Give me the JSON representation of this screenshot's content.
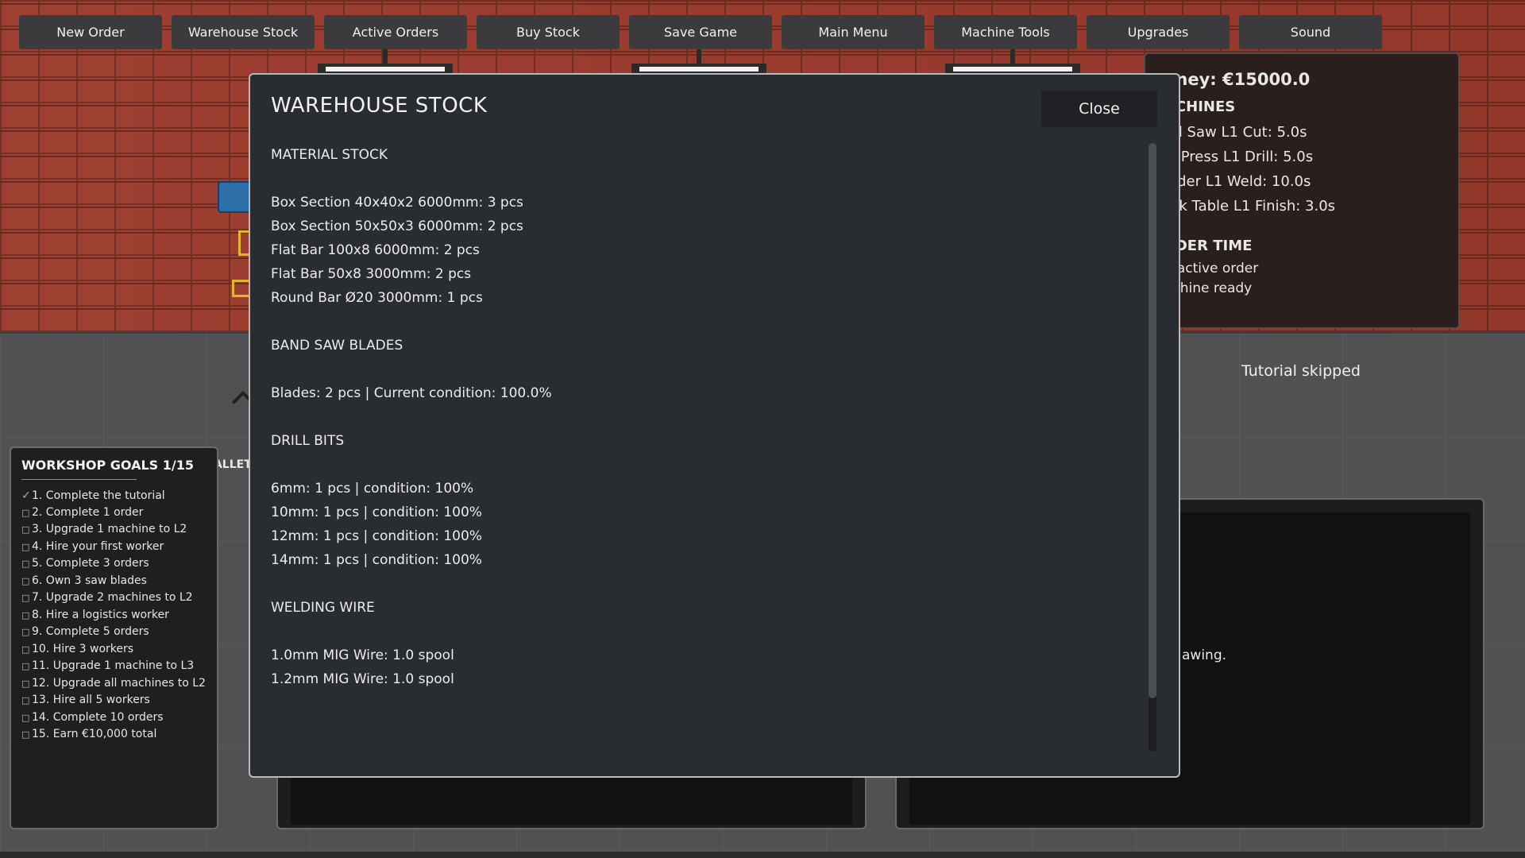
{
  "topmenu": {
    "buttons": [
      "New Order",
      "Warehouse Stock",
      "Active Orders",
      "Buy Stock",
      "Save Game",
      "Main Menu",
      "Machine Tools",
      "Upgrades",
      "Sound"
    ]
  },
  "info_panel": {
    "money": "oney: €15000.0",
    "machines_heading": "ACHINES",
    "machines": [
      "nd Saw  L1   Cut: 5.0s",
      "ill Press  L1   Drill: 5.0s",
      "elder  L1   Weld: 10.0s",
      "ork Table  L1   Finish: 3.0s"
    ],
    "order_time_heading": "RDER TIME",
    "order_status": "o active order",
    "machine_status": "achine ready"
  },
  "tutorial_status": "Tutorial skipped",
  "scene": {
    "pallet_label": "PALLET",
    "drawing_text": "awing."
  },
  "goals": {
    "title": "WORKSHOP GOALS  1/15",
    "items": [
      {
        "text": "1. Complete the tutorial",
        "done": true
      },
      {
        "text": "2. Complete 1 order",
        "done": false
      },
      {
        "text": "3. Upgrade 1 machine to L2",
        "done": false
      },
      {
        "text": "4. Hire your first worker",
        "done": false
      },
      {
        "text": "5. Complete 3 orders",
        "done": false
      },
      {
        "text": "6. Own 3 saw blades",
        "done": false
      },
      {
        "text": "7. Upgrade 2 machines to L2",
        "done": false
      },
      {
        "text": "8. Hire a logistics worker",
        "done": false
      },
      {
        "text": "9. Complete 5 orders",
        "done": false
      },
      {
        "text": "10. Hire 3 workers",
        "done": false
      },
      {
        "text": "11. Upgrade 1 machine to L3",
        "done": false
      },
      {
        "text": "12. Upgrade all machines to L2",
        "done": false
      },
      {
        "text": "13. Hire all 5 workers",
        "done": false
      },
      {
        "text": "14. Complete 10 orders",
        "done": false
      },
      {
        "text": "15. Earn €10,000 total",
        "done": false
      }
    ]
  },
  "modal": {
    "title": "WAREHOUSE STOCK",
    "close_label": "Close",
    "sections": [
      {
        "heading": "MATERIAL STOCK",
        "rows": [
          "Box Section 40x40x2 6000mm: 3 pcs",
          "Box Section 50x50x3 6000mm: 2 pcs",
          "Flat Bar 100x8 6000mm: 2 pcs",
          "Flat Bar 50x8 3000mm: 2 pcs",
          "Round Bar Ø20 3000mm: 1 pcs"
        ]
      },
      {
        "heading": "BAND SAW BLADES",
        "rows": [
          "Blades: 2 pcs | Current condition: 100.0%"
        ]
      },
      {
        "heading": "DRILL BITS",
        "rows": [
          "6mm: 1 pcs | condition: 100%",
          "10mm: 1 pcs | condition: 100%",
          "12mm: 1 pcs | condition: 100%",
          "14mm: 1 pcs | condition: 100%"
        ]
      },
      {
        "heading": "WELDING WIRE",
        "rows": [
          "1.0mm MIG Wire: 1.0 spool",
          "1.2mm MIG Wire: 1.0 spool"
        ]
      }
    ]
  },
  "colors": {
    "modal_bg": "#292c30",
    "menu_button": "#3b3b3d",
    "brick": "#9a3a2c",
    "goal_done": "#7ed07e"
  }
}
